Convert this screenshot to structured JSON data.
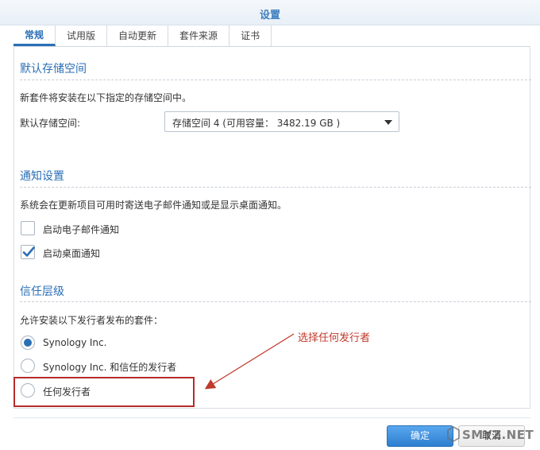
{
  "window": {
    "title": "设置"
  },
  "tabs": [
    {
      "label": "常规",
      "active": true
    },
    {
      "label": "试用版",
      "active": false
    },
    {
      "label": "自动更新",
      "active": false
    },
    {
      "label": "套件来源",
      "active": false
    },
    {
      "label": "证书",
      "active": false
    }
  ],
  "storage": {
    "section_title": "默认存储空间",
    "description": "新套件将安装在以下指定的存储空间中。",
    "field_label": "默认存储空间:",
    "selected_value": "存储空间 4 (可用容量： 3482.19 GB )"
  },
  "notifications": {
    "section_title": "通知设置",
    "description": "系统会在更新项目可用时寄送电子邮件通知或是显示桌面通知。",
    "options": [
      {
        "label": "启动电子邮件通知",
        "checked": false
      },
      {
        "label": "启动桌面通知",
        "checked": true
      }
    ]
  },
  "trust": {
    "section_title": "信任层级",
    "description": "允许安装以下发行者发布的套件：",
    "options": [
      {
        "label": "Synology Inc.",
        "selected": true
      },
      {
        "label": "Synology Inc. 和信任的发行者",
        "selected": false
      },
      {
        "label": "任何发行者",
        "selected": false
      }
    ]
  },
  "annotation": {
    "text": "选择任何发行者"
  },
  "footer": {
    "ok_label": "确定",
    "cancel_label": "取消"
  },
  "watermark": {
    "text": "SMYZ.NET"
  },
  "colors": {
    "accent": "#2a6fb5",
    "annotation": "#c0392b",
    "highlight_border": "#b72b2b"
  }
}
